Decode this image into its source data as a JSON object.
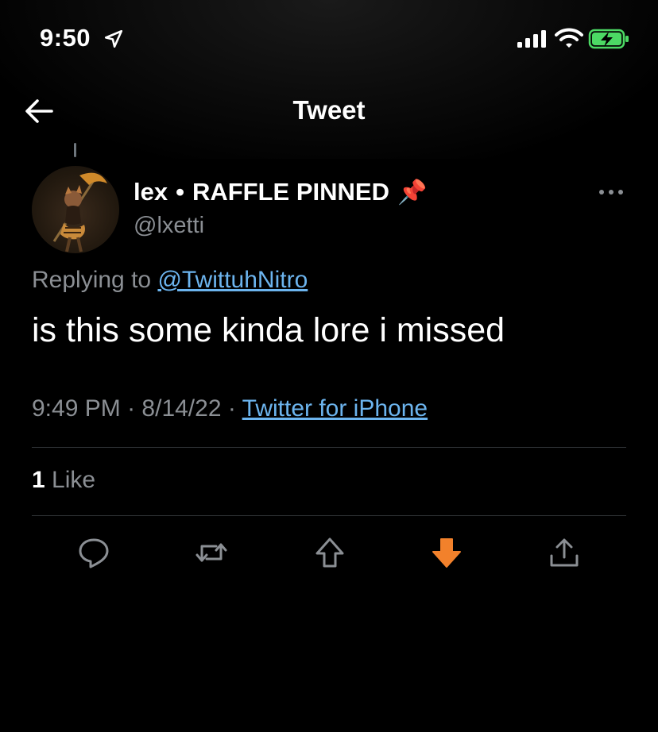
{
  "status_bar": {
    "time": "9:50"
  },
  "nav": {
    "title": "Tweet"
  },
  "author": {
    "name": "lex",
    "separator": "•",
    "status": "RAFFLE PINNED",
    "emoji": "📌",
    "handle": "@lxetti"
  },
  "reply": {
    "prefix": "Replying to",
    "mention": "@TwittuhNitro"
  },
  "tweet": {
    "text": "is this some kinda lore i missed"
  },
  "meta": {
    "time": "9:49 PM",
    "date": "8/14/22",
    "source": "Twitter for iPhone",
    "dot": "·"
  },
  "stats": {
    "likes_count": "1",
    "likes_label": "Like"
  },
  "actions": [
    {
      "name": "reply-icon"
    },
    {
      "name": "retweet-icon"
    },
    {
      "name": "upvote-icon"
    },
    {
      "name": "downvote-icon",
      "color": "#f2812b"
    },
    {
      "name": "share-icon"
    }
  ],
  "colors": {
    "link": "#6cb4ee",
    "muted": "#8b8f94",
    "battery": "#4cd964",
    "downvote": "#f2812b"
  }
}
